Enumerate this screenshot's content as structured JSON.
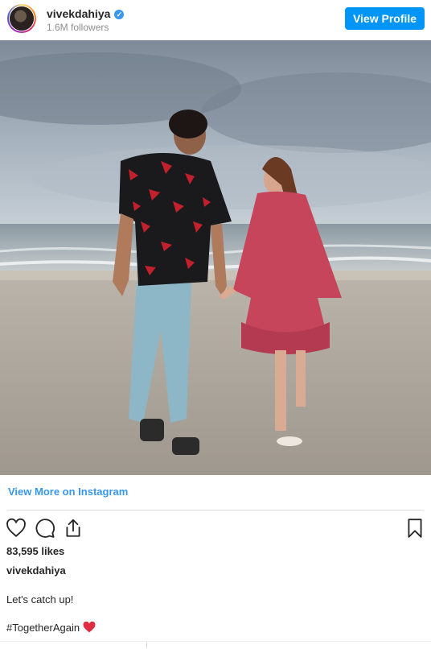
{
  "header": {
    "username": "vivekdahiya",
    "verified_mark": "✓",
    "followers": "1.6M followers",
    "view_profile_label": "View Profile"
  },
  "post": {
    "image_icon": "beach-couple-photo",
    "view_more_label": "View More on Instagram",
    "likes": "83,595 likes",
    "caption_user": "vivekdahiya",
    "caption_text": "Let's catch up!",
    "hashtag": "#TogetherAgain"
  },
  "actions": {
    "like_icon": "heart-icon",
    "comment_icon": "comment-icon",
    "share_icon": "share-icon",
    "save_icon": "bookmark-icon"
  },
  "colors": {
    "accent": "#0095f6",
    "link": "#3897f0",
    "text": "#262626",
    "muted": "#8e8e8e"
  }
}
